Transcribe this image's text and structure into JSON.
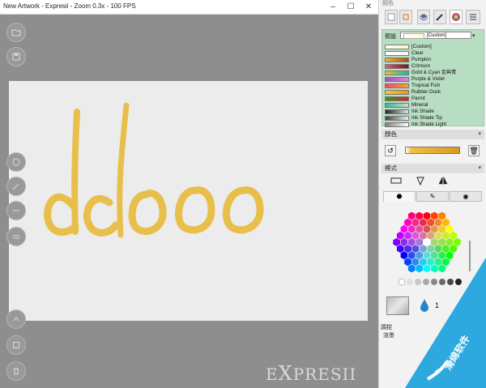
{
  "window": {
    "title": "New Artwork - Expresii - Zoom 0.3x - 100 FPS",
    "controls": [
      "–",
      "☐",
      "✕"
    ]
  },
  "panel": {
    "header": "顏色",
    "tabs": [
      "brush-icon",
      "layers-icon",
      "color-icon",
      "menu-icon"
    ],
    "presets": {
      "label": "預設",
      "selected": "[Custom]",
      "items": [
        {
          "name": "[Custom]",
          "colors": [
            "#ffffff",
            "#fff4c8"
          ]
        },
        {
          "name": "Clear",
          "colors": [
            "#ffffff",
            "#f5f5f5"
          ]
        },
        {
          "name": "Pumpkin",
          "colors": [
            "#f0b040",
            "#b05010"
          ]
        },
        {
          "name": "Crimson",
          "colors": [
            "#e06060",
            "#801020"
          ]
        },
        {
          "name": "Gold & Cyan 金與青",
          "colors": [
            "#f0c020",
            "#20b0c0"
          ]
        },
        {
          "name": "Purple & Violet",
          "colors": [
            "#a050c0",
            "#e080e0"
          ]
        },
        {
          "name": "Tropical Fish",
          "colors": [
            "#ff4080",
            "#ffa020"
          ]
        },
        {
          "name": "Rubber Duck",
          "colors": [
            "#f0d020",
            "#f09020"
          ]
        },
        {
          "name": "Parrot",
          "colors": [
            "#20a020",
            "#e02020"
          ]
        },
        {
          "name": "Mineral",
          "colors": [
            "#40b0a0",
            "#c0e0d0"
          ]
        },
        {
          "name": "Ink Shade",
          "colors": [
            "#202020",
            "#e0e0e0"
          ]
        },
        {
          "name": "Ink Shade Tip",
          "colors": [
            "#404040",
            "#f0f0f0"
          ]
        },
        {
          "name": "Ink Shade Light",
          "colors": [
            "#808080",
            "#ffffff"
          ]
        }
      ]
    },
    "color_section": "顏色",
    "mode_section": "模式",
    "drop_value": "1",
    "adjust_section": "調控",
    "adjust_row": "渲墨"
  },
  "watermark": {
    "logo": "EXPRESII"
  },
  "colors": {
    "panel_green": "#b7ddc3",
    "canvas_bg": "#8e8e8e",
    "paper": "#ececec",
    "stroke": "#e8b830",
    "badge": "#2da9e0"
  }
}
